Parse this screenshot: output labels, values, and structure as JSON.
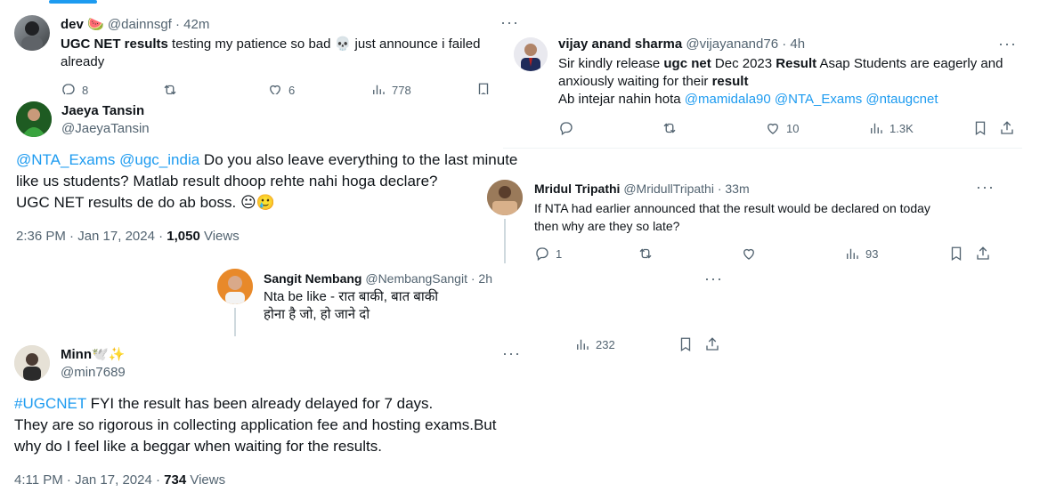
{
  "tweet_dev": {
    "name": "dev",
    "emoji": "🍉",
    "handle": "@dainnsgf",
    "time": "· 42m",
    "text_bold": "UGC NET results",
    "text_1": " testing my patience so bad ",
    "skull": "💀",
    "text_2": " just announce i failed",
    "text_3": "already",
    "reply_count": "8",
    "like_count": "6",
    "views": "778"
  },
  "tweet_jaeya": {
    "name": "Jaeya Tansin",
    "handle": "@JaeyaTansin",
    "mention_1": "@NTA_Exams",
    "mention_2": "@ugc_india",
    "line_1_rest": " Do you also leave everything to the last minute",
    "line_2": "like us students? Matlab result dhoop rehte nahi hoga declare?",
    "line_3": "UGC NET results de do ab boss. ",
    "emojis": "😐🥲",
    "timestamp": "2:36 PM · Jan 17, 2024 · ",
    "views_count": "1,050",
    "views_label": " Views"
  },
  "tweet_sangit": {
    "name": "Sangit Nembang",
    "handle": "@NembangSangit",
    "time": "· 2h",
    "line_1": "Nta be like - रात बाकी, बात बाकी",
    "line_2": "होना है जो, हो जाने दो"
  },
  "tweet_minn": {
    "name": "Minn",
    "emojis": "🕊️✨",
    "handle": "@min7689",
    "hashtag": "#UGCNET",
    "line_1_rest": " FYI the result has been already delayed for 7 days.",
    "line_2": "They are so rigorous in collecting application fee and hosting exams.But",
    "line_3": "why do I feel like a beggar when waiting for the results.",
    "timestamp": "4:11 PM · Jan 17, 2024 · ",
    "views_count": "734",
    "views_label": " Views"
  },
  "tweet_vijay": {
    "name": "vijay anand sharma",
    "handle": "@vijayanand76",
    "time": "· 4h",
    "l1_a": "Sir kindly release ",
    "l1_b": "ugc net",
    "l1_c": " Dec 2023 ",
    "l1_d": "Result",
    "l1_e": " Asap Students are eagerly and",
    "l2_a": "anxiously waiting for their ",
    "l2_b": "result",
    "l3_a": "Ab intejar nahin hota ",
    "m1": "@mamidala90",
    "m2": "@NTA_Exams",
    "m3": "@ntaugcnet",
    "like_count": "10",
    "views": "1.3K"
  },
  "tweet_mridul": {
    "name": "Mridul Tripathi",
    "handle": "@MridullTripathi",
    "time": "· 33m",
    "line_1": "If NTA had earlier announced that the result would be declared on today",
    "line_2": "then why are they so late?",
    "reply_count": "1",
    "views": "93"
  },
  "fragment": {
    "views": "232"
  }
}
